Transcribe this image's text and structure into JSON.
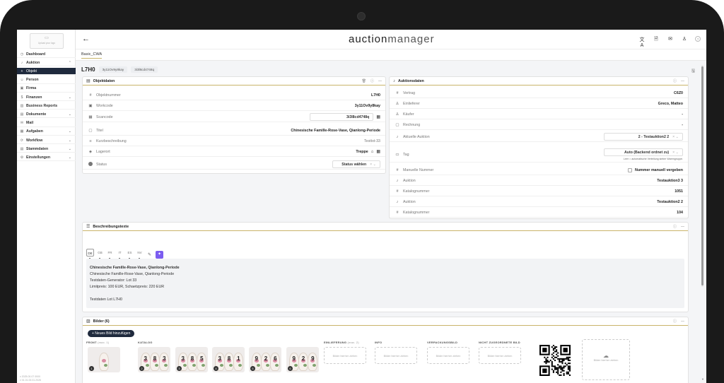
{
  "app": {
    "brand_a": "auction",
    "brand_b": "manager",
    "tab": "Basic_CWA"
  },
  "logo": {
    "glyph": "▭",
    "text": "Upload your logo"
  },
  "sidebar": {
    "items": [
      {
        "icon": "◷",
        "label": "Dashboard",
        "chevron": ""
      },
      {
        "icon": "♪",
        "label": "Auktion",
        "chevron": "⌃"
      },
      {
        "icon": "+",
        "label": "Objekt",
        "chevron": ""
      },
      {
        "icon": "☺",
        "label": "Person",
        "chevron": ""
      },
      {
        "icon": "▣",
        "label": "Firma",
        "chevron": ""
      },
      {
        "icon": "$",
        "label": "Finanzen",
        "chevron": "⌄"
      },
      {
        "icon": "▥",
        "label": "Business Reports",
        "chevron": ""
      },
      {
        "icon": "▤",
        "label": "Dokumente",
        "chevron": "⌄"
      },
      {
        "icon": "✉",
        "label": "Mail",
        "chevron": ""
      },
      {
        "icon": "▦",
        "label": "Aufgaben",
        "chevron": "⌄"
      },
      {
        "icon": "⟳",
        "label": "Workflow",
        "chevron": "⌄"
      },
      {
        "icon": "▤",
        "label": "Stammdaten",
        "chevron": "⌄"
      },
      {
        "icon": "⚙",
        "label": "Einstellungen",
        "chevron": "⌄"
      }
    ],
    "version_1": "v 2025.00.07 0000",
    "version_2": "v 01.01.00.01.2026"
  },
  "header": {
    "back_icon": "←",
    "icons": [
      "文A",
      "🗎",
      "✉",
      "♙"
    ],
    "help": "?"
  },
  "object": {
    "id": "L7H0",
    "code1": "3y11Ov9y8kay",
    "code2": "3i3l8cd4748q",
    "save_icon": "🖫"
  },
  "objektdaten": {
    "title": "Objektdaten",
    "rows": [
      {
        "icon": "#",
        "label": "Objektnummer",
        "value": "L7H0"
      },
      {
        "icon": "▣",
        "label": "Workcode",
        "value": "3y11Ov9y8kay"
      },
      {
        "icon": "▦",
        "label": "Scancode",
        "value": "3i3l8cd4748q"
      },
      {
        "icon": "▢",
        "label": "Titel",
        "value": "Chinesische Famille-Rose-Vase, Qianlong-Periode"
      },
      {
        "icon": "≡",
        "label": "Kurzbeschreibung",
        "value": "Testtxt-33"
      },
      {
        "icon": "◈",
        "label": "Lagerort",
        "value": "Treppe"
      },
      {
        "icon": "●",
        "label": "Status",
        "value": "Status wählen"
      }
    ]
  },
  "auktionsdaten": {
    "title": "Auktionsdaten",
    "rows": [
      {
        "icon": "#",
        "label": "Vertrag",
        "value": "C6Z0"
      },
      {
        "icon": "♙",
        "label": "Einlieferer",
        "value": "Greco, Matteo"
      },
      {
        "icon": "♙",
        "label": "Käufer",
        "value": "-"
      },
      {
        "icon": "▢",
        "label": "Rechnung",
        "value": "-"
      },
      {
        "icon": "♪",
        "label": "Aktuelle Auktion",
        "value": "2 - Testauktion2 2"
      },
      {
        "icon": "▭",
        "label": "Tag",
        "value": "Auto (Backend ordnet zu)"
      },
      {
        "icon": "#",
        "label": "Manuelle Nummer",
        "value": "Nummer manuell vergeben"
      },
      {
        "icon": "♪",
        "label": "Auktion",
        "value": "Testauktion3 3"
      },
      {
        "icon": "#",
        "label": "Katalognummer",
        "value": "1051"
      },
      {
        "icon": "♪",
        "label": "Auktion",
        "value": "Testauktion2 2"
      },
      {
        "icon": "#",
        "label": "Katalognummer",
        "value": "104"
      }
    ],
    "tag_hint": "Leer = automatische Verteilung sieber Warengruppe."
  },
  "beschreibung": {
    "title": "Beschreibungstexte",
    "langs": [
      "DE",
      "GB",
      "FR",
      "IT",
      "ES",
      "NV"
    ],
    "lines": [
      "Chinesische Famille-Rose-Vase, Qianlong-Periode",
      "Chinesische Famille-Rose-Vase, Qianlong-Periode",
      "Testdaten-Generator: Lot 33",
      "Limitpreis: 100 EUR, Schaetzpreis: 220 EUR",
      "",
      "Testdaten Lot L7H0"
    ]
  },
  "bilder": {
    "title": "Bilder (6)",
    "add_button": "+ Neues Bild hinzufügen",
    "groups": {
      "front": "FRONT",
      "front_max": "(max. 1)",
      "katalog": "KATALOG",
      "einlieferung": "EINLIEFERUNG",
      "einlieferung_max": "(max. 2)",
      "info": "INFO",
      "verpackung": "VERPACKUNGSBILD",
      "nicht": "NICHT ZUGEORDNETE BILD"
    },
    "thumbs": [
      {
        "badge": "1",
        "nums": ""
      },
      {
        "badge": "2",
        "nums": "3 8 3"
      },
      {
        "badge": "3",
        "nums": "3 8 5"
      },
      {
        "badge": "4",
        "nums": "3 8 1"
      },
      {
        "badge": "5",
        "nums": "9 2 6"
      },
      {
        "badge": "6",
        "nums": "9 2 9"
      }
    ],
    "drop_text": "Bilder hierher ziehen",
    "upload_text": "Bilder hierher ziehen"
  }
}
